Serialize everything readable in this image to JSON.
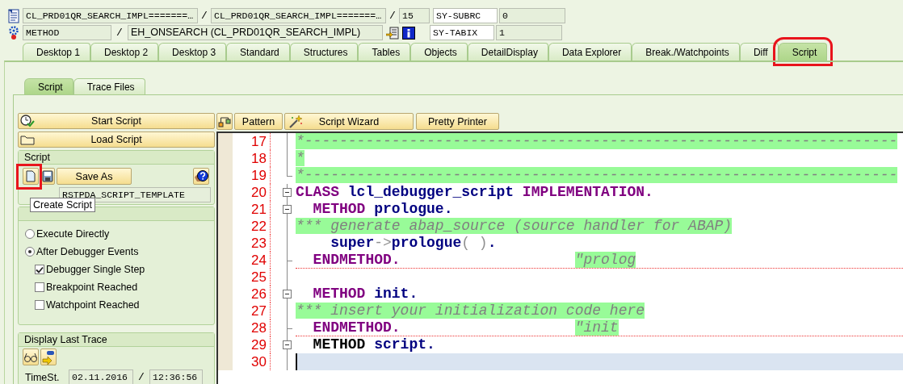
{
  "header": {
    "object_type": "CL_PRD01QR_SEARCH_IMPL=======…",
    "object_name": "CL_PRD01QR_SEARCH_IMPL=======…",
    "line": "15",
    "block_type": "METHOD",
    "block_name": "EH_ONSEARCH (CL_PRD01QR_SEARCH_IMPL)",
    "separators": [
      "/",
      "/",
      "/"
    ],
    "sys_fields": [
      {
        "name": "SY-SUBRC",
        "value": "0"
      },
      {
        "name": "SY-TABIX",
        "value": "1"
      }
    ]
  },
  "main_tabs": [
    {
      "label": "Desktop 1",
      "selected": false,
      "highlighted": false
    },
    {
      "label": "Desktop 2",
      "selected": false,
      "highlighted": false
    },
    {
      "label": "Desktop 3",
      "selected": false,
      "highlighted": false
    },
    {
      "label": "Standard",
      "selected": false,
      "highlighted": false
    },
    {
      "label": "Structures",
      "selected": false,
      "highlighted": false
    },
    {
      "label": "Tables",
      "selected": false,
      "highlighted": false
    },
    {
      "label": "Objects",
      "selected": false,
      "highlighted": false
    },
    {
      "label": "DetailDisplay",
      "selected": false,
      "highlighted": false
    },
    {
      "label": "Data Explorer",
      "selected": false,
      "highlighted": false
    },
    {
      "label": "Break./Watchpoints",
      "selected": false,
      "highlighted": false
    },
    {
      "label": "Diff",
      "selected": false,
      "highlighted": false
    },
    {
      "label": "Script",
      "selected": true,
      "highlighted": true
    }
  ],
  "sub_tabs": [
    {
      "label": "Script",
      "selected": true
    },
    {
      "label": "Trace Files",
      "selected": false
    }
  ],
  "actions": [
    {
      "label": "Start Script"
    },
    {
      "label": "Load Script"
    }
  ],
  "script_group": {
    "title": "Script",
    "create_highlighted": true,
    "save_label": "Save As",
    "name_value": "RSTPDA_SCRIPT_TEMPLATE",
    "tooltip": "Create Script"
  },
  "trigger_group": {
    "options": [
      {
        "kind": "radio",
        "label": "Execute Directly",
        "selected": false
      },
      {
        "kind": "radio",
        "label": "After Debugger Events",
        "selected": true
      },
      {
        "kind": "checkbox",
        "label": "Debugger Single Step",
        "checked": true
      },
      {
        "kind": "checkbox",
        "label": "Breakpoint Reached",
        "checked": false
      },
      {
        "kind": "checkbox",
        "label": "Watchpoint Reached",
        "checked": false
      }
    ]
  },
  "trace_group": {
    "title": "Display Last Trace",
    "time_label": "TimeSt.",
    "date": "02.11.2016",
    "separator": "/",
    "time": "12:36:56"
  },
  "editor_toolbar": [
    {
      "label": "Pattern"
    },
    {
      "label": "Script Wizard"
    },
    {
      "label": "Pretty Printer"
    }
  ],
  "code_lines": [
    {
      "number": "17",
      "kind": "line",
      "separator": false,
      "current": false,
      "segments": [
        {
          "kind": "comment",
          "text": "*--------------------------------------------------------------------"
        }
      ]
    },
    {
      "number": "18",
      "kind": "line",
      "separator": false,
      "current": false,
      "segments": [
        {
          "kind": "comment",
          "text": "*"
        }
      ]
    },
    {
      "number": "19",
      "kind": "corner",
      "separator": false,
      "current": false,
      "segments": [
        {
          "kind": "comment",
          "text": "*--------------------------------------------------------------------"
        }
      ]
    },
    {
      "number": "20",
      "kind": "open",
      "separator": false,
      "current": false,
      "segments": [
        {
          "kind": "keyword",
          "text": "CLASS "
        },
        {
          "kind": "name",
          "text": "lcl_debugger_script "
        },
        {
          "kind": "keyword",
          "text": "IMPLEMENTATION."
        }
      ]
    },
    {
      "number": "21",
      "kind": "open",
      "separator": false,
      "current": false,
      "segments": [
        {
          "kind": "keyword",
          "text": "  METHOD "
        },
        {
          "kind": "name",
          "text": "prologue."
        }
      ]
    },
    {
      "number": "22",
      "kind": "line",
      "separator": false,
      "current": false,
      "segments": [
        {
          "kind": "comment",
          "text": "*** generate abap_source (source handler for ABAP)"
        }
      ]
    },
    {
      "number": "23",
      "kind": "line",
      "separator": false,
      "current": false,
      "segments": [
        {
          "kind": "name",
          "text": "    super"
        },
        {
          "kind": "operator",
          "text": "->"
        },
        {
          "kind": "name",
          "text": "prologue"
        },
        {
          "kind": "operator",
          "text": "( )"
        },
        {
          "kind": "name",
          "text": "."
        }
      ]
    },
    {
      "number": "24",
      "kind": "end",
      "separator": true,
      "current": false,
      "segments": [
        {
          "kind": "keyword",
          "text": "  ENDMETHOD.                    "
        },
        {
          "kind": "comment",
          "text": "\"prolog"
        }
      ]
    },
    {
      "number": "25",
      "kind": "line",
      "separator": false,
      "current": false
    },
    {
      "number": "26",
      "kind": "open",
      "separator": false,
      "current": false,
      "segments": [
        {
          "kind": "keyword",
          "text": "  METHOD "
        },
        {
          "kind": "name",
          "text": "init."
        }
      ]
    },
    {
      "number": "27",
      "kind": "line",
      "separator": false,
      "current": false,
      "segments": [
        {
          "kind": "comment",
          "text": "*** insert your initialization code here"
        }
      ]
    },
    {
      "number": "28",
      "kind": "end",
      "separator": true,
      "current": false,
      "segments": [
        {
          "kind": "keyword",
          "text": "  ENDMETHOD.                    "
        },
        {
          "kind": "comment",
          "text": "\"init"
        }
      ]
    },
    {
      "number": "29",
      "kind": "open",
      "separator": false,
      "current": false,
      "segments": [
        {
          "kind": "statement",
          "text": "  METHOD "
        },
        {
          "kind": "name",
          "text": "script."
        }
      ]
    },
    {
      "number": "30",
      "kind": "line",
      "separator": false,
      "current": true
    }
  ]
}
